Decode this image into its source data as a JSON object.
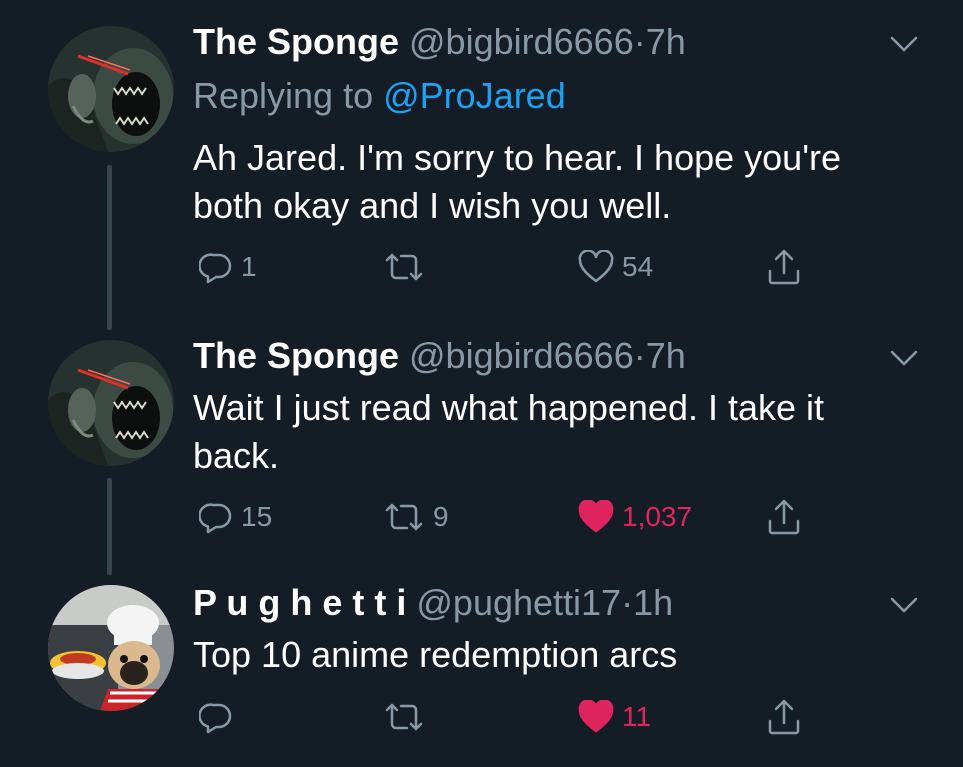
{
  "tweets": [
    {
      "name": "The Sponge",
      "handle": "@bigbird6666",
      "dot": "·",
      "time": "7h",
      "replying_prefix": "Replying to ",
      "replying_to": "@ProJared",
      "text": "Ah Jared. I'm sorry to hear. I hope you're both okay and I wish you well.",
      "replies": "1",
      "retweets": "",
      "likes": "54",
      "liked": false
    },
    {
      "name": "The Sponge",
      "handle": "@bigbird6666",
      "dot": "·",
      "time": "7h",
      "text": "Wait I just read what happened. I take it back.",
      "replies": "15",
      "retweets": "9",
      "likes": "1,037",
      "liked": true
    },
    {
      "name": "P u g h e t t i",
      "handle": "@pughetti17",
      "dot": "·",
      "time": "1h",
      "text": "Top 10 anime redemption arcs",
      "replies": "",
      "retweets": "",
      "likes": "11",
      "liked": true
    }
  ],
  "icons": {
    "reply": "reply-icon",
    "retweet": "retweet-icon",
    "like": "heart-icon",
    "share": "share-icon",
    "menu": "chevron-down-icon"
  },
  "colors": {
    "background": "#141d26",
    "secondary_text": "#8899a6",
    "link": "#1da1f2",
    "like_active": "#e0245e",
    "thread_line": "#38444d"
  }
}
